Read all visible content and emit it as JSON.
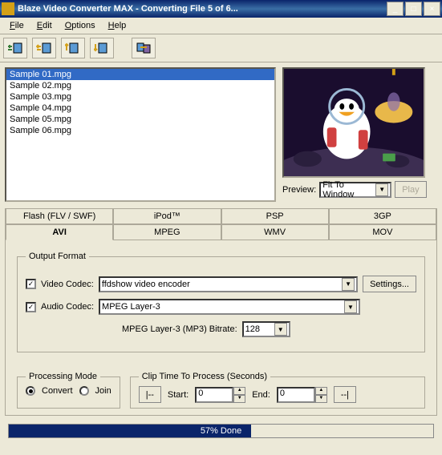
{
  "window": {
    "title": "Blaze Video Converter MAX - Converting File 5 of 6..."
  },
  "menu": {
    "file": "File",
    "edit": "Edit",
    "options": "Options",
    "help": "Help"
  },
  "files": {
    "items": [
      "Sample 01.mpg",
      "Sample 02.mpg",
      "Sample 03.mpg",
      "Sample 04.mpg",
      "Sample 05.mpg",
      "Sample 06.mpg"
    ],
    "selected_index": 0
  },
  "preview": {
    "label": "Preview:",
    "mode": "Fit To Window",
    "play": "Play"
  },
  "tabs": {
    "row1": [
      "Flash (FLV / SWF)",
      "iPod™",
      "PSP",
      "3GP"
    ],
    "row2": [
      "AVI",
      "MPEG",
      "WMV",
      "MOV"
    ],
    "active": "AVI"
  },
  "output": {
    "legend": "Output Format",
    "video_codec_label": "Video Codec:",
    "video_codec": "ffdshow video encoder",
    "audio_codec_label": "Audio Codec:",
    "audio_codec": "MPEG Layer-3",
    "bitrate_label": "MPEG Layer-3 (MP3) Bitrate:",
    "bitrate": "128",
    "settings": "Settings..."
  },
  "processing": {
    "legend": "Processing Mode",
    "convert": "Convert",
    "join": "Join"
  },
  "clip": {
    "legend": "Clip Time To Process (Seconds)",
    "back": "|--",
    "fwd": "--|",
    "start_label": "Start:",
    "start": "0",
    "end_label": "End:",
    "end": "0"
  },
  "progress": {
    "percent": 57,
    "text": "57% Done"
  }
}
